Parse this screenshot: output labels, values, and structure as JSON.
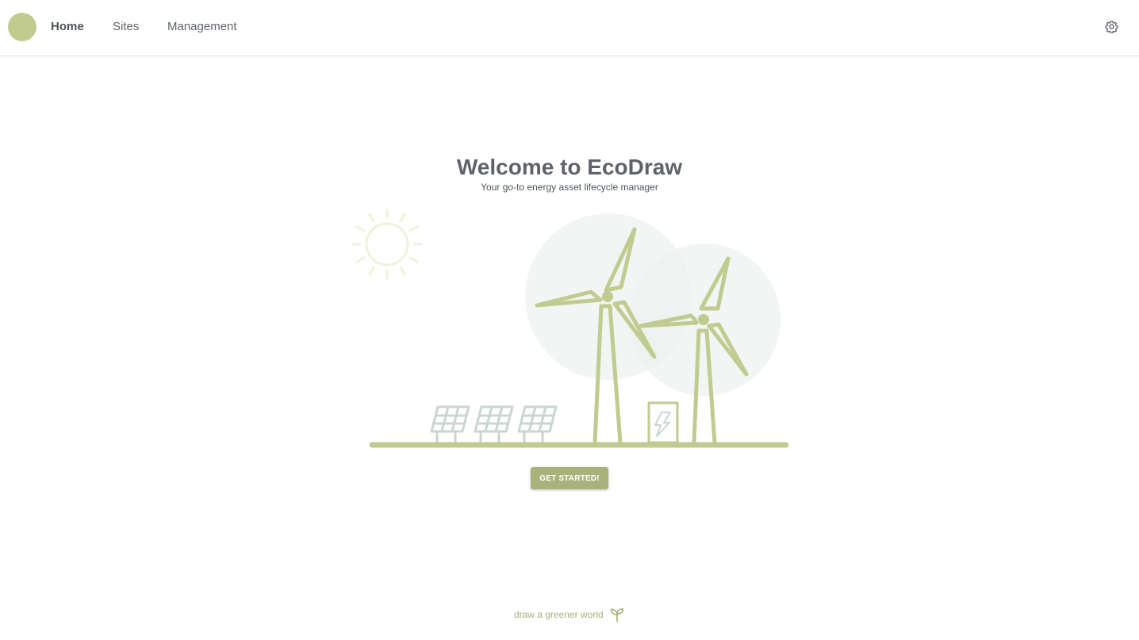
{
  "nav": {
    "items": [
      {
        "label": "Home",
        "active": true
      },
      {
        "label": "Sites",
        "active": false
      },
      {
        "label": "Management",
        "active": false
      }
    ],
    "settings_icon": "gear-icon"
  },
  "hero": {
    "title": "Welcome to EcoDraw",
    "subtitle": "Your go-to energy asset lifecycle manager",
    "button_label": "GET STARTED!"
  },
  "footer": {
    "text": "draw a greener world",
    "icon": "sprout-icon"
  },
  "colors": {
    "accent": "#c2cb8f",
    "button": "#a9b27a",
    "text": "#5f6368",
    "sun": "#f1f1dc",
    "panel": "#c9d6d2",
    "bubble": "#eef2f0"
  }
}
